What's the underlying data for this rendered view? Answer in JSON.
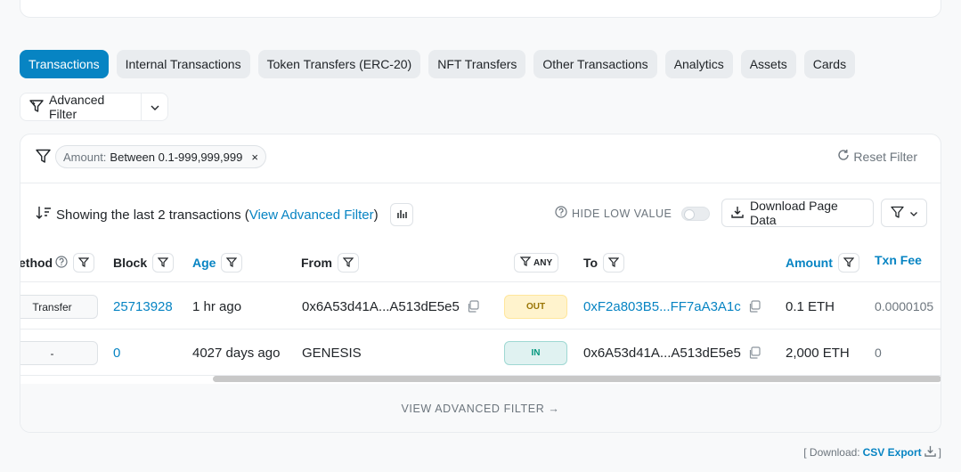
{
  "tabs": [
    {
      "label": "Transactions"
    },
    {
      "label": "Internal Transactions"
    },
    {
      "label": "Token Transfers (ERC-20)"
    },
    {
      "label": "NFT Transfers"
    },
    {
      "label": "Other Transactions"
    },
    {
      "label": "Analytics"
    },
    {
      "label": "Assets"
    },
    {
      "label": "Cards"
    }
  ],
  "advanced_filter": {
    "label": "Advanced Filter"
  },
  "filter_chip": {
    "key": "Amount:",
    "value": "Between 0.1-999,999,999",
    "close": "×"
  },
  "reset_filter": "Reset Filter",
  "summary": {
    "prefix": "Showing the last 2 transactions (",
    "link": "View Advanced Filter",
    "suffix": ")"
  },
  "hide_low_value": "HIDE LOW VALUE",
  "download_page_data": "Download Page Data",
  "columns": {
    "method": "ethod",
    "block": "Block",
    "age": "Age",
    "from": "From",
    "any": "ANY",
    "to": "To",
    "amount": "Amount",
    "txn_fee": "Txn Fee"
  },
  "rows": [
    {
      "method": "Transfer",
      "block": "25713928",
      "age": "1 hr ago",
      "from": "0x6A53d41A...A513dE5e5",
      "direction": "OUT",
      "to": "0xF2a803B5...FF7aA3A1c",
      "amount": "0.1 ETH",
      "fee": "0.0000105"
    },
    {
      "method": "-",
      "block": "0",
      "age": "4027 days ago",
      "from": "GENESIS",
      "direction": "IN",
      "to": "0x6A53d41A...A513dE5e5",
      "amount": "2,000 ETH",
      "fee": "0"
    }
  ],
  "footer_link": "VIEW ADVANCED FILTER →",
  "csv": {
    "prefix": "[ Download:",
    "link": "CSV Export",
    "suffix": "]"
  },
  "colors": {
    "accent": "#0784c3",
    "out_badge": "#fff3cd",
    "in_badge": "#e0f2f1"
  }
}
